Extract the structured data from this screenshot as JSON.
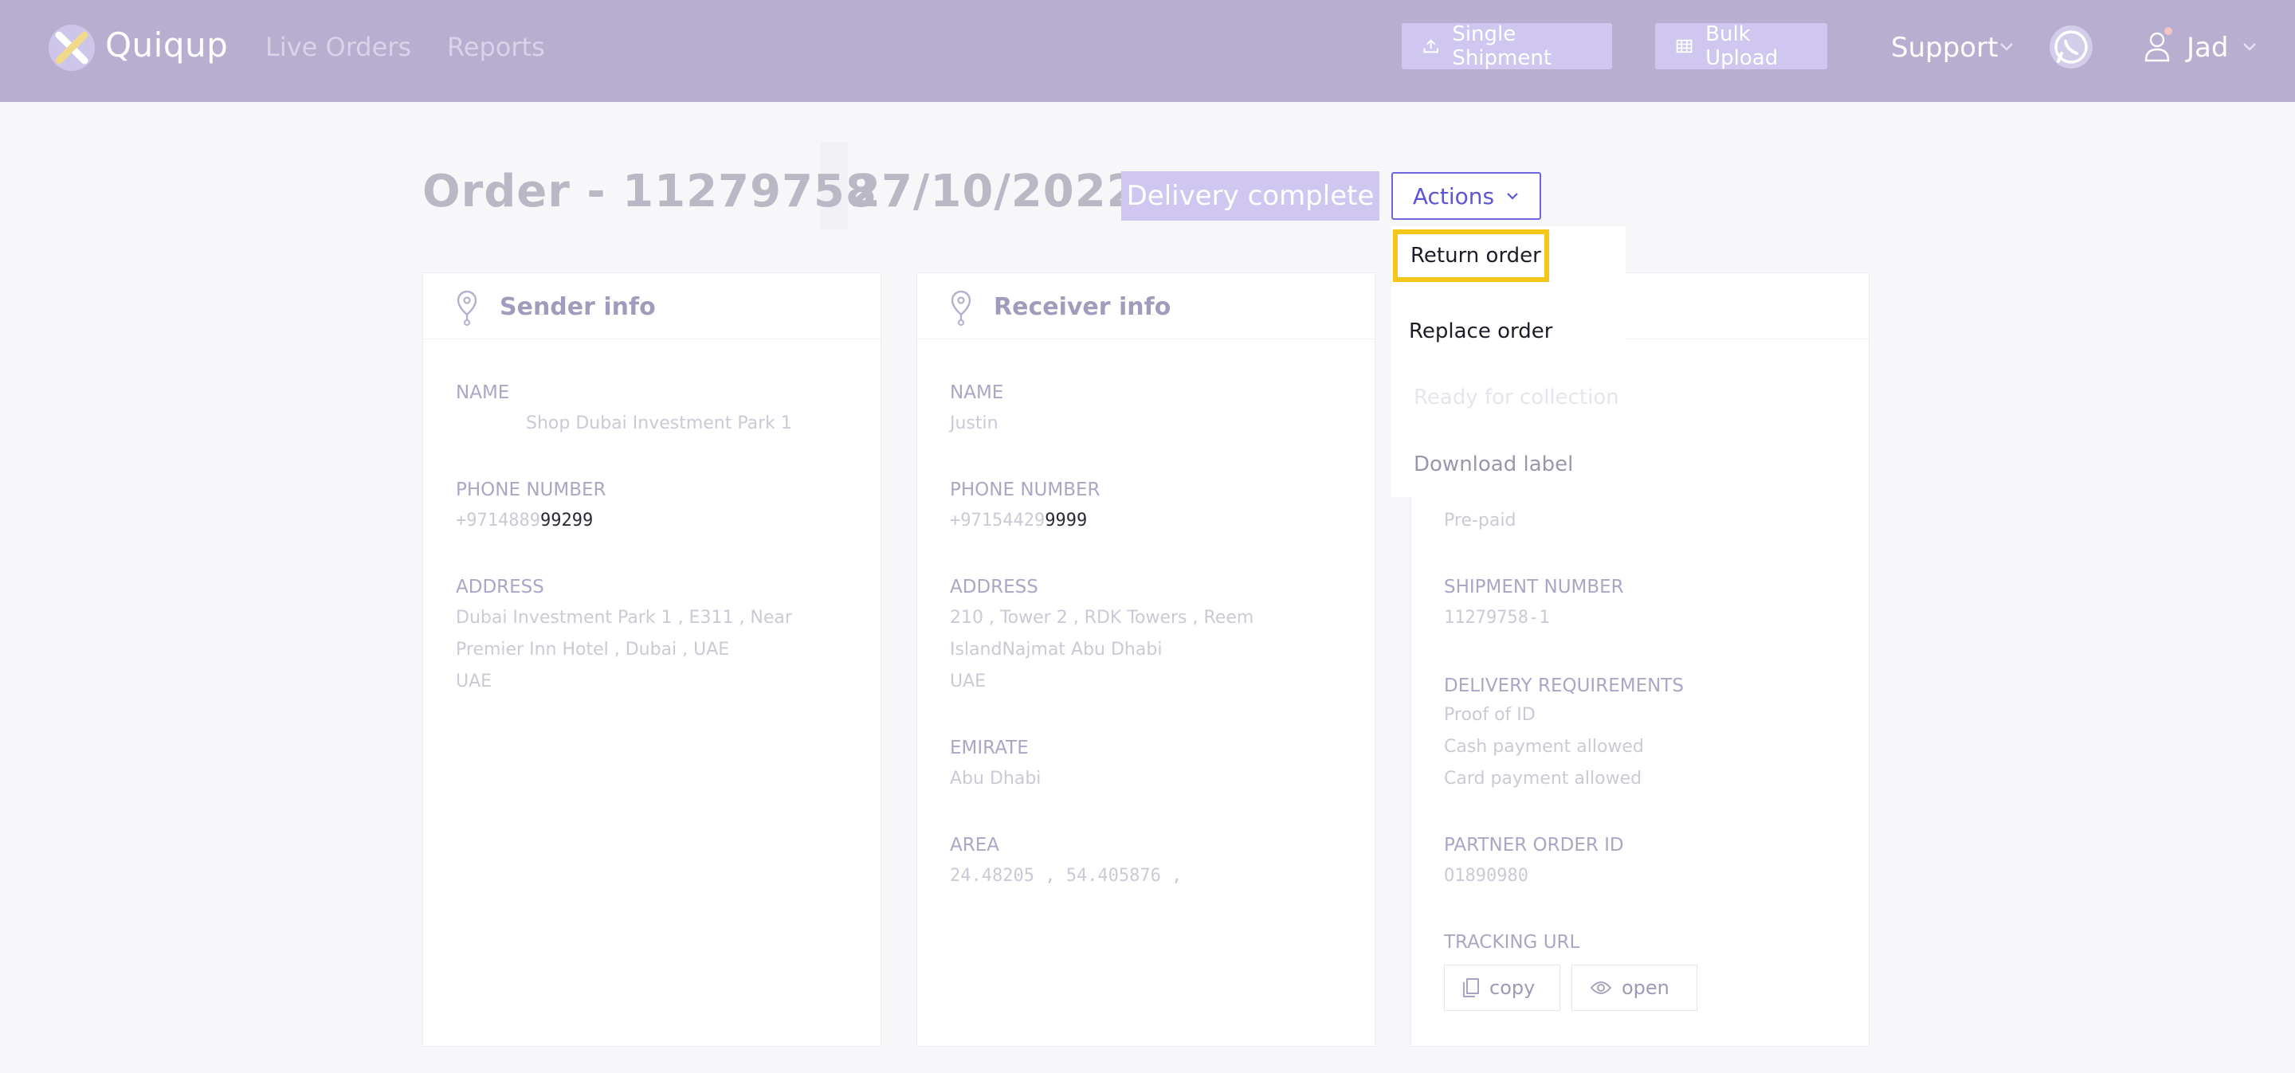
{
  "nav": {
    "brand": "Quiqup",
    "links": [
      "Live Orders",
      "Reports"
    ],
    "single_shipment": "Single Shipment",
    "bulk_upload": "Bulk Upload",
    "support": "Support",
    "user": "Jad"
  },
  "order": {
    "title": "Order - 11279758",
    "date": "27/10/2022",
    "status": "Delivery complete",
    "actions_label": "Actions"
  },
  "actions_menu": {
    "items": [
      "Return order",
      "Replace order",
      "Ready for collection",
      "Download label"
    ]
  },
  "sender": {
    "title": "Sender info",
    "name_label": "NAME",
    "name": "Shop Dubai Investment Park 1",
    "phone_label": "PHONE NUMBER",
    "phone_a": "+9714889",
    "phone_b": "992",
    "phone_c": "99",
    "address_label": "ADDRESS",
    "address_lines": [
      "Dubai Investment Park 1 , E311 , Near",
      "Premier Inn Hotel , Dubai , UAE",
      "UAE"
    ]
  },
  "receiver": {
    "title": "Receiver info",
    "name_label": "NAME",
    "name": "Justin",
    "phone_label": "PHONE NUMBER",
    "phone_a": "+97154429",
    "phone_b": "99",
    "phone_c": "99",
    "address_label": "ADDRESS",
    "address_lines": [
      "210 , Tower 2 , RDK Towers , Reem",
      "IslandNajmat Abu Dhabi",
      "UAE"
    ],
    "emirate_label": "EMIRATE",
    "emirate": "Abu Dhabi",
    "area_label": "AREA",
    "area": "24.48205 , 54.405876 ,"
  },
  "shipment": {
    "payment": "Pre-paid",
    "shipment_number_label": "SHIPMENT NUMBER",
    "shipment_number": "11279758-1",
    "requirements_label": "DELIVERY REQUIREMENTS",
    "requirements": [
      "Proof of ID",
      "Cash payment allowed",
      "Card payment allowed"
    ],
    "partner_order_label": "PARTNER ORDER ID",
    "partner_order_id": "O1890980",
    "tracking_label": "TRACKING URL",
    "copy_label": "copy",
    "open_label": "open"
  }
}
